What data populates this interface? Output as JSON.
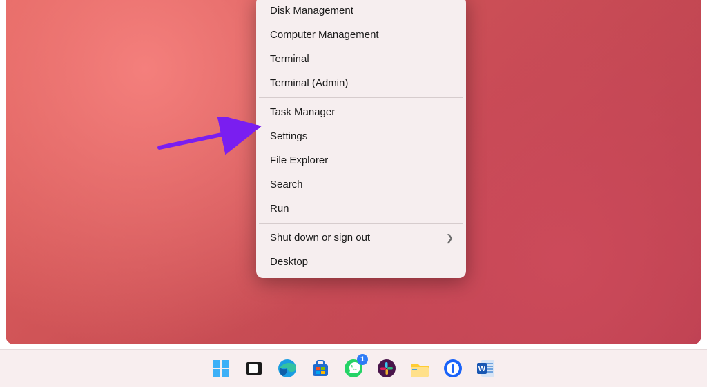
{
  "menu": {
    "group0": [
      {
        "label": "Disk Management"
      },
      {
        "label": "Computer Management"
      },
      {
        "label": "Terminal"
      },
      {
        "label": "Terminal (Admin)"
      }
    ],
    "group1": [
      {
        "label": "Task Manager"
      },
      {
        "label": "Settings"
      },
      {
        "label": "File Explorer"
      },
      {
        "label": "Search"
      },
      {
        "label": "Run"
      }
    ],
    "group2": [
      {
        "label": "Shut down or sign out",
        "submenu": true
      },
      {
        "label": "Desktop"
      }
    ]
  },
  "annotation": {
    "target": "Task Manager",
    "color": "#7a1ef0"
  },
  "taskbar": {
    "icons": [
      {
        "name": "start-icon"
      },
      {
        "name": "task-view-icon"
      },
      {
        "name": "edge-icon"
      },
      {
        "name": "microsoft-store-icon"
      },
      {
        "name": "whatsapp-icon",
        "badge": "1"
      },
      {
        "name": "slack-icon"
      },
      {
        "name": "file-explorer-icon"
      },
      {
        "name": "1password-icon"
      },
      {
        "name": "word-icon"
      }
    ]
  },
  "colors": {
    "menu_bg": "#f6eeef",
    "accent": "#2e7bf6",
    "wallpaper_a": "#e0625d",
    "wallpaper_b": "#b33a4c"
  }
}
